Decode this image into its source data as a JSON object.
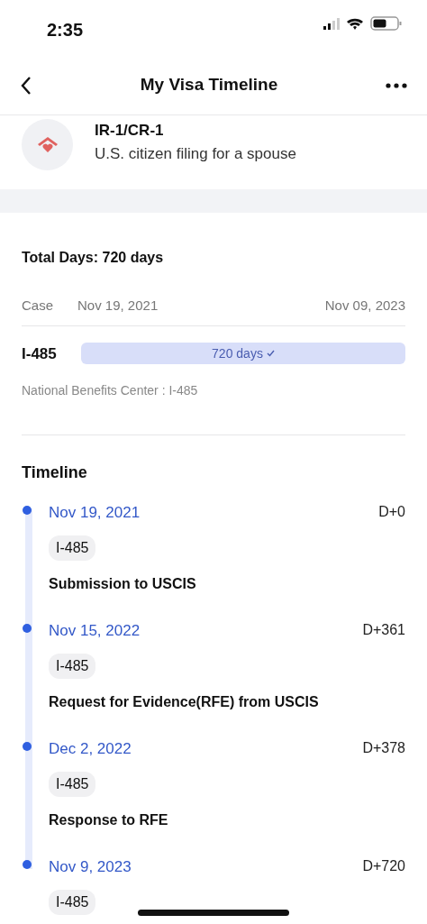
{
  "status_bar": {
    "time": "2:35"
  },
  "nav": {
    "title": "My Visa Timeline"
  },
  "visa": {
    "code": "IR-1/CR-1",
    "description": "U.S. citizen filing for a spouse"
  },
  "summary": {
    "total": "Total Days: 720 days",
    "case_label": "Case",
    "start": "Nov 19, 2021",
    "end": "Nov 09, 2023",
    "form": "I-485",
    "bar_label": "720 days",
    "bar_done": true,
    "level": 1,
    "center": "National Benefits Center : I-485"
  },
  "timeline": {
    "title": "Timeline",
    "events": [
      {
        "date": "Nov 19, 2021",
        "day": "D+0",
        "tag": "I-485",
        "title": "Submission to USCIS"
      },
      {
        "date": "Nov 15, 2022",
        "day": "D+361",
        "tag": "I-485",
        "title": "Request for Evidence(RFE) from USCIS"
      },
      {
        "date": "Dec 2, 2022",
        "day": "D+378",
        "tag": "I-485",
        "title": "Response to RFE"
      },
      {
        "date": "Nov 9, 2023",
        "day": "D+720",
        "tag": "I-485"
      }
    ]
  }
}
